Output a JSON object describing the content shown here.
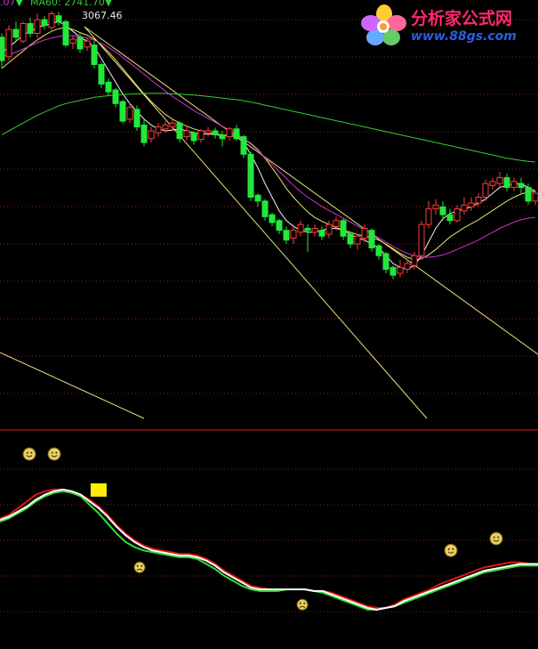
{
  "header": {
    "prefix": ".07",
    "prefix_arrow": "▼",
    "ma_label": "MA60: 2741.70",
    "ma_arrow": "▼"
  },
  "logo": {
    "title": "分析家公式网",
    "url": "www.88gs.com"
  },
  "colors": {
    "background": "#000000",
    "up_candle": "#ff3b3b",
    "down_candle": "#22e83a",
    "ma_short": "#f2f2f2",
    "ma_mid": "#e8e070",
    "ma_long": "#cc33cc",
    "ma_60": "#33cc33",
    "trendline": "#e6e07a",
    "grid": "#8a1e1e",
    "divider": "#d81e1e",
    "osc_red": "#e01515",
    "osc_white": "#ffffff",
    "osc_green": "#33dd33",
    "marker": "#ffee00",
    "smiley": "#e8d060"
  },
  "chart_data": [
    {
      "type": "candlestick",
      "panel": "price",
      "peak_label": "3067.46",
      "ylim": [
        2000,
        3100
      ],
      "candles": [
        [
          3000,
          2940,
          3010,
          2920
        ],
        [
          2950,
          3020,
          3030,
          2940
        ],
        [
          3020,
          3000,
          3040,
          2990
        ],
        [
          2990,
          3035,
          3040,
          2985
        ],
        [
          3035,
          3010,
          3050,
          3000
        ],
        [
          3010,
          3045,
          3060,
          2998
        ],
        [
          3045,
          3030,
          3055,
          3020
        ],
        [
          3025,
          3060,
          3067,
          3018
        ],
        [
          3055,
          3040,
          3065,
          3030
        ],
        [
          3040,
          2980,
          3045,
          2975
        ],
        [
          2985,
          2995,
          3005,
          2970
        ],
        [
          3000,
          2970,
          3010,
          2960
        ],
        [
          2975,
          2990,
          3000,
          2965
        ],
        [
          2980,
          2930,
          2990,
          2920
        ],
        [
          2930,
          2880,
          2935,
          2870
        ],
        [
          2885,
          2860,
          2895,
          2850
        ],
        [
          2865,
          2830,
          2870,
          2820
        ],
        [
          2835,
          2785,
          2840,
          2780
        ],
        [
          2790,
          2820,
          2830,
          2780
        ],
        [
          2815,
          2770,
          2825,
          2760
        ],
        [
          2775,
          2730,
          2790,
          2720
        ],
        [
          2740,
          2760,
          2770,
          2730
        ],
        [
          2755,
          2770,
          2780,
          2745
        ],
        [
          2765,
          2775,
          2785,
          2755
        ],
        [
          2770,
          2780,
          2790,
          2760
        ],
        [
          2780,
          2740,
          2785,
          2730
        ],
        [
          2745,
          2760,
          2770,
          2735
        ],
        [
          2755,
          2735,
          2760,
          2725
        ],
        [
          2738,
          2760,
          2765,
          2730
        ],
        [
          2755,
          2760,
          2770,
          2745
        ],
        [
          2760,
          2750,
          2768,
          2740
        ],
        [
          2750,
          2740,
          2760,
          2720
        ],
        [
          2745,
          2765,
          2770,
          2735
        ],
        [
          2765,
          2740,
          2775,
          2735
        ],
        [
          2745,
          2700,
          2750,
          2690
        ],
        [
          2700,
          2590,
          2705,
          2580
        ],
        [
          2595,
          2580,
          2600,
          2565
        ],
        [
          2580,
          2540,
          2585,
          2530
        ],
        [
          2545,
          2525,
          2550,
          2515
        ],
        [
          2530,
          2505,
          2535,
          2495
        ],
        [
          2505,
          2480,
          2515,
          2470
        ],
        [
          2485,
          2505,
          2520,
          2470
        ],
        [
          2500,
          2520,
          2530,
          2490
        ],
        [
          2510,
          2505,
          2520,
          2450
        ],
        [
          2500,
          2510,
          2520,
          2490
        ],
        [
          2505,
          2490,
          2515,
          2480
        ],
        [
          2495,
          2520,
          2530,
          2485
        ],
        [
          2515,
          2530,
          2540,
          2505
        ],
        [
          2530,
          2490,
          2535,
          2480
        ],
        [
          2495,
          2470,
          2500,
          2460
        ],
        [
          2470,
          2490,
          2495,
          2455
        ],
        [
          2485,
          2510,
          2520,
          2475
        ],
        [
          2505,
          2460,
          2510,
          2450
        ],
        [
          2465,
          2440,
          2470,
          2430
        ],
        [
          2445,
          2405,
          2450,
          2395
        ],
        [
          2410,
          2390,
          2415,
          2380
        ],
        [
          2395,
          2410,
          2430,
          2385
        ],
        [
          2405,
          2420,
          2430,
          2395
        ],
        [
          2415,
          2440,
          2450,
          2405
        ],
        [
          2440,
          2520,
          2530,
          2430
        ],
        [
          2520,
          2560,
          2580,
          2510
        ],
        [
          2560,
          2570,
          2585,
          2545
        ],
        [
          2565,
          2545,
          2580,
          2530
        ],
        [
          2545,
          2530,
          2560,
          2520
        ],
        [
          2530,
          2560,
          2570,
          2525
        ],
        [
          2555,
          2570,
          2590,
          2545
        ],
        [
          2565,
          2575,
          2590,
          2555
        ],
        [
          2575,
          2590,
          2600,
          2565
        ],
        [
          2590,
          2625,
          2635,
          2580
        ],
        [
          2620,
          2630,
          2640,
          2610
        ],
        [
          2625,
          2640,
          2655,
          2615
        ],
        [
          2640,
          2615,
          2650,
          2605
        ],
        [
          2615,
          2630,
          2640,
          2605
        ],
        [
          2625,
          2615,
          2640,
          2600
        ],
        [
          2615,
          2580,
          2625,
          2570
        ],
        [
          2580,
          2600,
          2610,
          2570
        ]
      ],
      "series": [
        {
          "role": "ma_short",
          "values": [
            2960,
            2975,
            2990,
            3005,
            3015,
            3025,
            3030,
            3035,
            3040,
            3030,
            3015,
            3000,
            2990,
            2975,
            2945,
            2915,
            2885,
            2855,
            2830,
            2810,
            2790,
            2775,
            2765,
            2760,
            2762,
            2765,
            2760,
            2755,
            2752,
            2752,
            2750,
            2748,
            2748,
            2745,
            2730,
            2700,
            2665,
            2625,
            2590,
            2555,
            2530,
            2515,
            2505,
            2500,
            2500,
            2505,
            2510,
            2510,
            2505,
            2495,
            2485,
            2480,
            2470,
            2460,
            2440,
            2420,
            2410,
            2405,
            2415,
            2440,
            2475,
            2510,
            2535,
            2548,
            2555,
            2560,
            2565,
            2575,
            2585,
            2600,
            2615,
            2620,
            2625,
            2625,
            2615,
            2605
          ]
        },
        {
          "role": "ma_mid",
          "values": [
            2920,
            2935,
            2950,
            2965,
            2980,
            2993,
            3005,
            3015,
            3022,
            3025,
            3020,
            3012,
            3005,
            2995,
            2980,
            2962,
            2942,
            2920,
            2898,
            2876,
            2855,
            2835,
            2818,
            2802,
            2790,
            2780,
            2772,
            2765,
            2760,
            2756,
            2752,
            2750,
            2748,
            2746,
            2740,
            2728,
            2712,
            2690,
            2665,
            2640,
            2612,
            2590,
            2570,
            2552,
            2538,
            2528,
            2520,
            2512,
            2506,
            2500,
            2494,
            2490,
            2486,
            2480,
            2470,
            2458,
            2446,
            2436,
            2430,
            2432,
            2442,
            2456,
            2472,
            2488,
            2500,
            2512,
            2522,
            2532,
            2544,
            2556,
            2568,
            2580,
            2590,
            2598,
            2603,
            2605
          ]
        },
        {
          "role": "ma_long",
          "values": [
            2950,
            2955,
            2962,
            2970,
            2978,
            2986,
            2993,
            2998,
            3002,
            3004,
            3004,
            3002,
            2998,
            2992,
            2984,
            2974,
            2962,
            2948,
            2934,
            2920,
            2905,
            2890,
            2876,
            2862,
            2848,
            2836,
            2824,
            2812,
            2802,
            2792,
            2782,
            2772,
            2762,
            2752,
            2740,
            2726,
            2710,
            2692,
            2674,
            2656,
            2638,
            2620,
            2604,
            2590,
            2578,
            2566,
            2556,
            2546,
            2536,
            2526,
            2516,
            2506,
            2496,
            2486,
            2475,
            2464,
            2454,
            2446,
            2440,
            2436,
            2436,
            2438,
            2442,
            2448,
            2456,
            2464,
            2472,
            2480,
            2490,
            2500,
            2510,
            2518,
            2526,
            2532,
            2536,
            2538
          ]
        },
        {
          "role": "ma_60",
          "values": [
            2750,
            2760,
            2770,
            2780,
            2790,
            2800,
            2808,
            2816,
            2824,
            2830,
            2834,
            2838,
            2842,
            2846,
            2848,
            2850,
            2852,
            2853,
            2854,
            2855,
            2856,
            2856,
            2856,
            2856,
            2855,
            2854,
            2853,
            2852,
            2850,
            2848,
            2846,
            2844,
            2842,
            2840,
            2837,
            2834,
            2830,
            2826,
            2822,
            2818,
            2814,
            2810,
            2806,
            2802,
            2798,
            2794,
            2790,
            2786,
            2782,
            2778,
            2774,
            2770,
            2766,
            2762,
            2758,
            2754,
            2750,
            2746,
            2742,
            2738,
            2734,
            2730,
            2726,
            2722,
            2718,
            2714,
            2710,
            2706,
            2702,
            2698,
            2694,
            2690,
            2687,
            2684,
            2682,
            2680
          ]
        }
      ]
    },
    {
      "type": "line",
      "panel": "oscillator",
      "ylim": [
        0,
        100
      ],
      "x": [
        0,
        1,
        2,
        3,
        4,
        5,
        6,
        7,
        8,
        9,
        10,
        11,
        12,
        13,
        14,
        15,
        16,
        17,
        18,
        19,
        20,
        21,
        22,
        23,
        24,
        25,
        26,
        27,
        28,
        29,
        30,
        31,
        32,
        33,
        34,
        35,
        36,
        37,
        38,
        39,
        40,
        41,
        42,
        43,
        44,
        45,
        46,
        47,
        48,
        49,
        50,
        51,
        52,
        53,
        54,
        55,
        56,
        57,
        58,
        59,
        60
      ],
      "series": [
        {
          "role": "osc_red",
          "values": [
            62,
            64,
            68,
            72,
            76,
            78,
            79,
            79,
            78,
            76,
            73,
            69,
            64,
            58,
            53,
            49,
            46,
            44,
            43,
            42,
            41,
            41,
            40,
            38,
            35,
            31,
            28,
            25,
            22,
            21,
            20,
            20,
            20,
            20,
            20,
            19,
            19,
            18,
            16,
            14,
            12,
            10,
            9,
            9,
            11,
            14,
            16,
            18,
            20,
            23,
            25,
            27,
            29,
            31,
            33,
            34,
            35,
            36,
            36,
            35,
            35
          ]
        },
        {
          "role": "osc_white",
          "values": [
            61,
            63,
            66,
            69,
            73,
            76,
            78,
            79,
            78,
            76,
            72,
            68,
            63,
            57,
            52,
            48,
            45,
            43,
            42,
            41,
            40,
            40,
            39,
            37,
            34,
            30,
            27,
            24,
            21,
            20,
            20,
            20,
            20,
            20,
            20,
            19,
            19,
            17,
            15,
            13,
            11,
            9,
            8,
            9,
            10,
            13,
            15,
            17,
            19,
            21,
            23,
            25,
            27,
            29,
            31,
            32,
            33,
            34,
            35,
            35,
            35
          ]
        },
        {
          "role": "osc_green",
          "values": [
            60,
            62,
            65,
            68,
            72,
            75,
            77,
            78,
            77,
            75,
            70,
            65,
            59,
            53,
            48,
            45,
            43,
            42,
            41,
            40,
            39,
            39,
            38,
            35,
            32,
            28,
            25,
            22,
            20,
            19,
            19,
            19,
            20,
            20,
            20,
            19,
            18,
            16,
            14,
            12,
            10,
            8,
            8,
            9,
            10,
            12,
            14,
            16,
            18,
            20,
            22,
            24,
            26,
            28,
            30,
            31,
            32,
            33,
            34,
            34,
            34
          ]
        }
      ],
      "signal_markers": [
        {
          "kind": "square",
          "x": 11,
          "value": 79
        },
        {
          "kind": "smile",
          "x": 4,
          "value": 100
        },
        {
          "kind": "smile",
          "x": 8,
          "value": 100
        },
        {
          "kind": "smile",
          "x": 66,
          "value": 43
        },
        {
          "kind": "smile",
          "x": 72,
          "value": 50
        },
        {
          "kind": "frown",
          "x": 20,
          "value": 33
        },
        {
          "kind": "frown",
          "x": 45,
          "value": 11
        }
      ]
    }
  ]
}
